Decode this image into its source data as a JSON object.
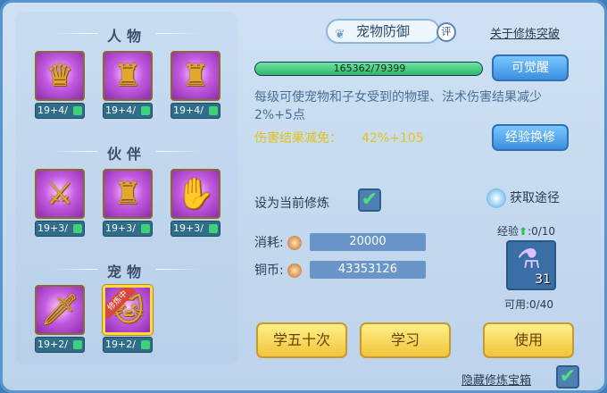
{
  "left": {
    "sections": [
      {
        "title": "人物",
        "skills": [
          {
            "icon": "warrior-helmet-icon",
            "glyph": "♛",
            "level": "19+4/"
          },
          {
            "icon": "armor-icon",
            "glyph": "♜",
            "level": "19+4/"
          },
          {
            "icon": "armor-icon",
            "glyph": "♜",
            "level": "19+4/"
          }
        ]
      },
      {
        "title": "伙伴",
        "skills": [
          {
            "icon": "sword-lion-icon",
            "glyph": "⚔",
            "level": "19+3/"
          },
          {
            "icon": "armor-lion-icon",
            "glyph": "♜",
            "level": "19+3/"
          },
          {
            "icon": "claw-lion-icon",
            "glyph": "✋",
            "level": "19+3/"
          }
        ]
      },
      {
        "title": "宠物",
        "skills": [
          {
            "icon": "sword-cat-icon",
            "glyph": "🗡",
            "level": "19+2/"
          },
          {
            "icon": "cat-icon",
            "glyph": "🐱",
            "level": "19+2/",
            "ribbon": "修炼中"
          }
        ]
      }
    ]
  },
  "right": {
    "title": "宠物防御",
    "review_badge": "评",
    "about_link": "关于修炼突破",
    "progress": {
      "current": 165362,
      "max": 79399,
      "text": "165362/79399",
      "fill": 1.0
    },
    "awaken_button": "可觉醒",
    "description": "每级可使宠物和子女受到的物理、法术伤害结果减少2%+5点",
    "effect_label": "伤害结果减免：",
    "effect_value": "42%+105",
    "exchange_button": "经验换修",
    "set_current_label": "设为当前修炼",
    "set_current_checked": true,
    "get_path_label": "获取途径",
    "cost_label": "消耗:",
    "cost_value": "20000",
    "copper_label": "铜币:",
    "copper_value": "43353126",
    "exp_label": "经验",
    "exp_value": ":0/10",
    "item_count": "31",
    "usable_label": "可用:0/40",
    "btn_learn50": "学五十次",
    "btn_learn": "学习",
    "btn_use": "使用",
    "hide_chest_label": "隐藏修炼宝箱",
    "hide_chest_checked": true
  }
}
